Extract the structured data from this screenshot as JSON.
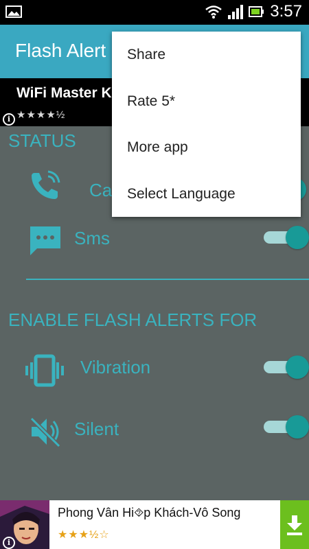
{
  "status_bar": {
    "time": "3:57",
    "icons": [
      "image-icon",
      "wifi-icon",
      "signal-icon",
      "battery-icon"
    ]
  },
  "app": {
    "title": "Flash Alert"
  },
  "top_ad": {
    "title": "WiFi Master Ke",
    "rating_stars": "★★★★½",
    "info_icon": "i"
  },
  "sections": {
    "status": {
      "header": "STATUS",
      "rows": [
        {
          "label": "Ca",
          "icon": "phone-ringing-icon",
          "enabled": true
        },
        {
          "label": "Sms",
          "icon": "message-icon",
          "enabled": true
        }
      ]
    },
    "enable": {
      "header": "ENABLE FLASH ALERTS FOR",
      "rows": [
        {
          "label": "Vibration",
          "icon": "vibration-icon",
          "enabled": true
        },
        {
          "label": "Silent",
          "icon": "silent-icon",
          "enabled": true
        }
      ]
    }
  },
  "menu": {
    "items": [
      {
        "label": "Share"
      },
      {
        "label": "Rate 5*"
      },
      {
        "label": "More app"
      },
      {
        "label": "Select Language"
      }
    ]
  },
  "bottom_ad": {
    "title": "Phong Vân Hi\u0000p Khách-Vô Song",
    "title_display": "Phong Vân Hi⯑p Khách-Vô Song",
    "rating_stars": "★★★½☆",
    "info_icon": "i",
    "download_icon": "download-icon"
  },
  "colors": {
    "accent": "#3ab3bf",
    "appbar": "#3aa8c1",
    "background": "#5b6463",
    "toggle_thumb": "#189a97",
    "toggle_track": "#a6d7d7",
    "download": "#6cbf1e"
  }
}
